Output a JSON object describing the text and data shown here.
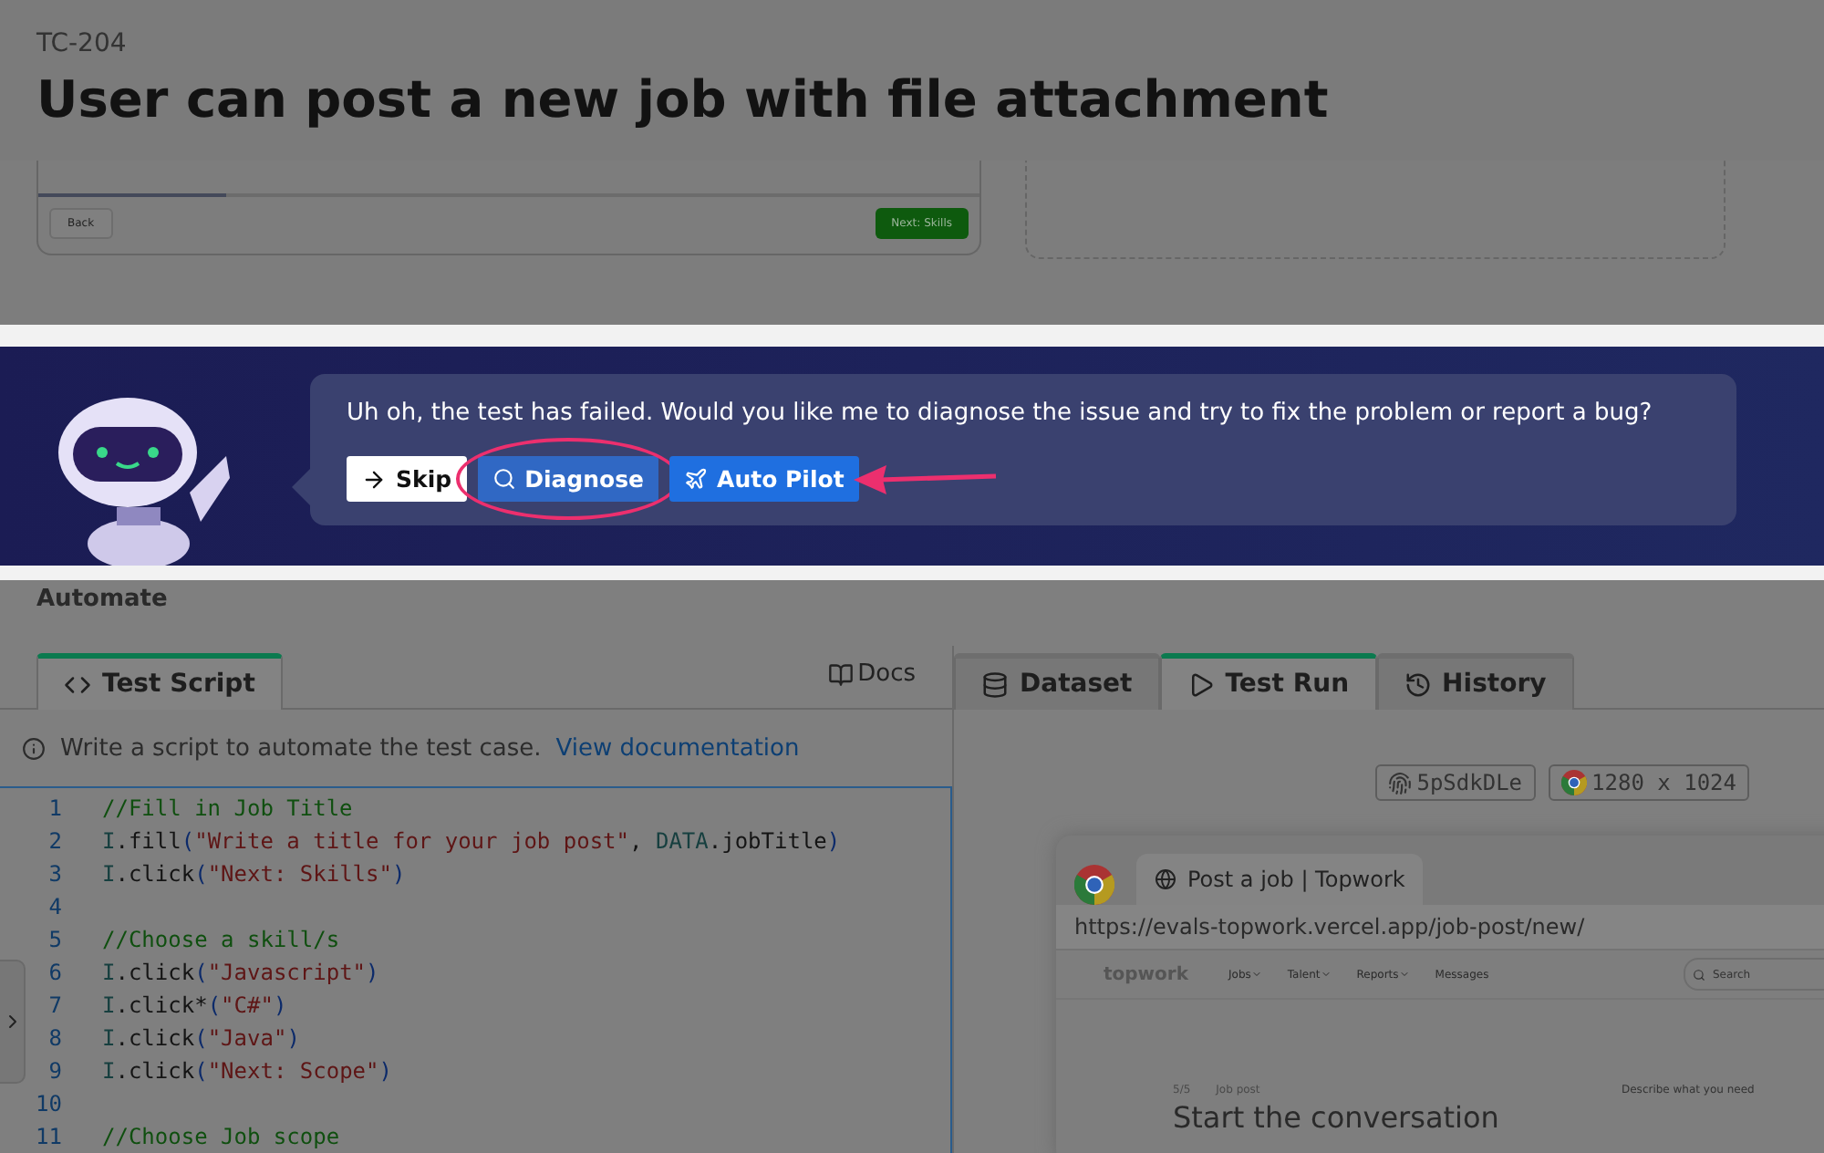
{
  "header": {
    "case_id": "TC-204",
    "title": "User can post a new job with file attachment"
  },
  "preview_card": {
    "progress": {
      "level": 0.2
    },
    "back_button": "Back",
    "next_button": "Next: Skills"
  },
  "assistant_banner": {
    "message": "Uh oh, the test has failed. Would you like me to diagnose the issue and try to fix the problem or report a bug?",
    "buttons": [
      {
        "label": "Skip",
        "kind": "skip",
        "highlighted": false
      },
      {
        "label": "Diagnose",
        "kind": "diagnose",
        "highlighted": true
      },
      {
        "label": "Auto Pilot",
        "kind": "autopilot",
        "highlighted": false
      }
    ]
  },
  "section_title": "Automate",
  "script_panel": {
    "tabs": [
      {
        "label": "Test Script",
        "selected": true
      }
    ],
    "docs_button": "Docs",
    "hint": "Write a script to automate the test case.",
    "hint_link": "View documentation",
    "code_lines": [
      {
        "number": "1",
        "tokens": [
          {
            "kind": "comment",
            "text": "//Fill in Job Title"
          }
        ]
      },
      {
        "number": "2",
        "tokens": [
          {
            "kind": "ident",
            "text": "I"
          },
          {
            "kind": "plain",
            "text": ".fill"
          },
          {
            "kind": "paren",
            "text": "("
          },
          {
            "kind": "string",
            "text": "\"Write a title for your job post\""
          },
          {
            "kind": "plain",
            "text": ", "
          },
          {
            "kind": "ident",
            "text": "DATA"
          },
          {
            "kind": "plain",
            "text": ".jobTitle"
          },
          {
            "kind": "paren",
            "text": ")"
          }
        ]
      },
      {
        "number": "3",
        "tokens": [
          {
            "kind": "ident",
            "text": "I"
          },
          {
            "kind": "plain",
            "text": ".click"
          },
          {
            "kind": "paren",
            "text": "("
          },
          {
            "kind": "string",
            "text": "\"Next: Skills\""
          },
          {
            "kind": "paren",
            "text": ")"
          }
        ]
      },
      {
        "number": "4"
      },
      {
        "number": "5",
        "tokens": [
          {
            "kind": "comment",
            "text": "//Choose a skill/s"
          }
        ]
      },
      {
        "number": "6",
        "tokens": [
          {
            "kind": "ident",
            "text": "I"
          },
          {
            "kind": "plain",
            "text": ".click"
          },
          {
            "kind": "paren",
            "text": "("
          },
          {
            "kind": "string",
            "text": "\"Javascript\""
          },
          {
            "kind": "paren",
            "text": ")"
          }
        ]
      },
      {
        "number": "7",
        "tokens": [
          {
            "kind": "ident",
            "text": "I"
          },
          {
            "kind": "plain",
            "text": ".click*"
          },
          {
            "kind": "paren",
            "text": "("
          },
          {
            "kind": "string",
            "text": "\"C#\""
          },
          {
            "kind": "paren",
            "text": ")"
          }
        ]
      },
      {
        "number": "8",
        "tokens": [
          {
            "kind": "ident",
            "text": "I"
          },
          {
            "kind": "plain",
            "text": ".click"
          },
          {
            "kind": "paren",
            "text": "("
          },
          {
            "kind": "string",
            "text": "\"Java\""
          },
          {
            "kind": "paren",
            "text": ")"
          }
        ]
      },
      {
        "number": "9",
        "tokens": [
          {
            "kind": "ident",
            "text": "I"
          },
          {
            "kind": "plain",
            "text": ".click"
          },
          {
            "kind": "paren",
            "text": "("
          },
          {
            "kind": "string",
            "text": "\"Next: Scope\""
          },
          {
            "kind": "paren",
            "text": ")"
          }
        ]
      },
      {
        "number": "10"
      },
      {
        "number": "11",
        "tokens": [
          {
            "kind": "comment",
            "text": "//Choose Job scope"
          }
        ]
      }
    ]
  },
  "run_panel": {
    "tabs": [
      {
        "label": "Dataset",
        "selected": false
      },
      {
        "label": "Test Run",
        "selected": true
      },
      {
        "label": "History",
        "selected": false
      }
    ],
    "session_id": "5pSdkDLe",
    "resolution": "1280 x 1024",
    "browser": {
      "tab_title": "Post a job | Topwork",
      "url": "https://evals-topwork.vercel.app/job-post/new/",
      "logo": "topwork",
      "nav": [
        {
          "label": "Jobs",
          "dropdown": true
        },
        {
          "label": "Talent",
          "dropdown": true
        },
        {
          "label": "Reports",
          "dropdown": true
        },
        {
          "label": "Messages",
          "dropdown": false
        }
      ],
      "search_placeholder": "Search",
      "step": "5/5",
      "step_label": "Job post",
      "heading": "Start the conversation",
      "side_label": "Describe what you need"
    }
  }
}
